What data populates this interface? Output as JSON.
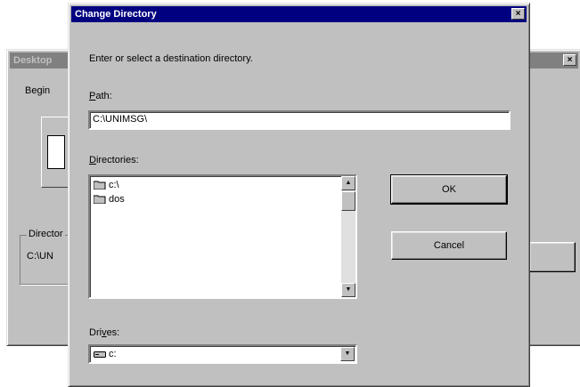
{
  "background_window": {
    "title": "Desktop",
    "begin_label": "Begin",
    "group_label": "Director",
    "path_value": "C:\\UN"
  },
  "dialog": {
    "title": "Change Directory",
    "close_glyph": "×",
    "instruction": "Enter or select a destination directory.",
    "path_label_hotkey": "P",
    "path_label_rest": "ath:",
    "path_value": "C:\\UNIMSG\\",
    "directories_label_hotkey": "D",
    "directories_label_rest": "irectories:",
    "directories": [
      {
        "name": "c:\\",
        "icon": "open-folder-icon"
      },
      {
        "name": "dos",
        "icon": "folder-icon"
      }
    ],
    "drives_label_pre": "Dri",
    "drives_label_hotkey": "v",
    "drives_label_rest": "es:",
    "drive_value": "c:",
    "ok_label": "OK",
    "cancel_label": "Cancel"
  }
}
